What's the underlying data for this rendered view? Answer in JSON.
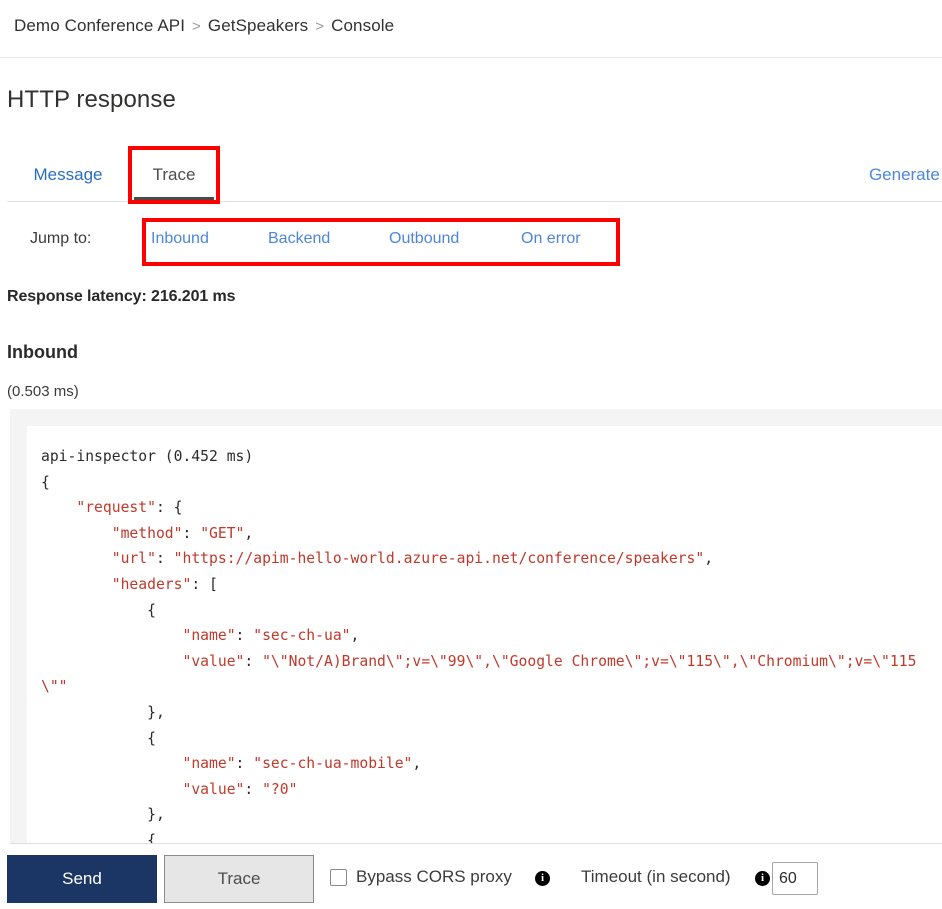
{
  "breadcrumb": {
    "items": [
      "Demo Conference API",
      "GetSpeakers",
      "Console"
    ],
    "separator": ">"
  },
  "page_title": "HTTP response",
  "tabs": {
    "message_label": "Message",
    "trace_label": "Trace",
    "generate_link": "Generate d"
  },
  "jump_to": {
    "label": "Jump to:",
    "links": [
      "Inbound",
      "Backend",
      "Outbound",
      "On error"
    ]
  },
  "latency": "Response latency: 216.201 ms",
  "section": {
    "title": "Inbound",
    "duration": "(0.503 ms)"
  },
  "code": {
    "header": "api-inspector (0.452 ms)",
    "open_brace": "{",
    "request_key": "\"request\"",
    "request_open": ": {",
    "method_key": "\"method\"",
    "method_val": "\"GET\"",
    "url_key": "\"url\"",
    "url_val": "\"https://apim-hello-world.azure-api.net/conference/speakers\"",
    "headers_key": "\"headers\"",
    "headers_open": ": [",
    "h1_open": "{",
    "h1_name_key": "\"name\"",
    "h1_name_val": "\"sec-ch-ua\"",
    "h1_value_key": "\"value\"",
    "h1_value_val": "\"\\\"Not/A)Brand\\\";v=\\\"99\\\",\\\"Google Chrome\\\";v=\\\"115\\\",\\\"Chromium\\\";v=\\\"115\\\"\"",
    "h1_close": "},",
    "h2_open": "{",
    "h2_name_key": "\"name\"",
    "h2_name_val": "\"sec-ch-ua-mobile\"",
    "h2_value_key": "\"value\"",
    "h2_value_val": "\"?0\"",
    "h2_close": "},",
    "h3_open": "{"
  },
  "toolbar": {
    "send_label": "Send",
    "trace_label": "Trace",
    "bypass_cors_label": "Bypass CORS proxy",
    "bypass_cors_checked": false,
    "timeout_label": "Timeout (in second)",
    "timeout_value": "60",
    "info_glyph": "i"
  },
  "colors": {
    "link_blue": "#4c86d9",
    "send_navy": "#1b3664",
    "annotation_red": "#ff0000",
    "code_string": "#c0392b"
  }
}
